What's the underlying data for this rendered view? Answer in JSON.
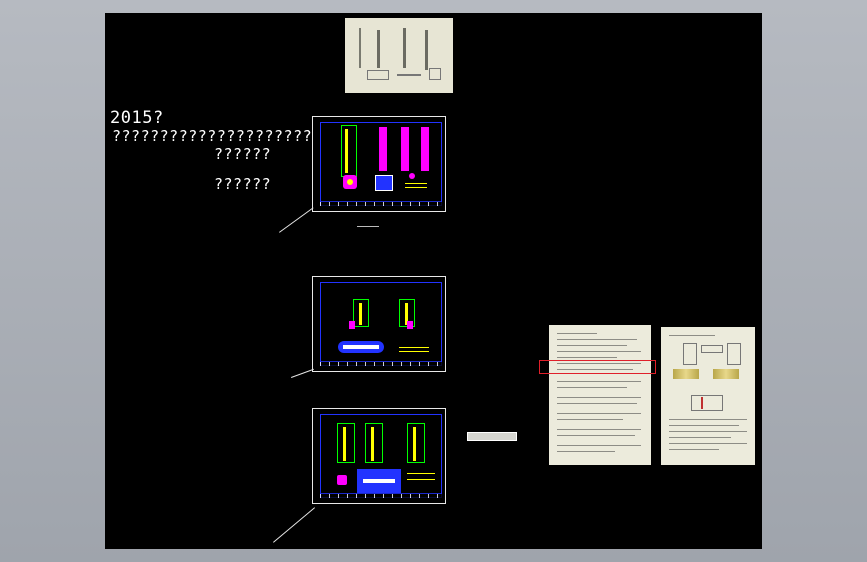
{
  "canvas": {
    "background": "#000000",
    "annotation_year": "2015?",
    "annotation_line_1": "?????????????????????",
    "annotation_line_2": "??????",
    "annotation_line_3": "??????"
  },
  "sheets": [
    {
      "name": "sheet-1",
      "caption": ""
    },
    {
      "name": "sheet-2",
      "caption": ""
    },
    {
      "name": "sheet-3",
      "caption": ""
    }
  ],
  "highlight": {
    "color": "#e0202a"
  },
  "colors": {
    "magenta": "#ff00ff",
    "yellow": "#ffff00",
    "green": "#00ff00",
    "blue": "#2233ff",
    "paper": "#ecebdc"
  }
}
